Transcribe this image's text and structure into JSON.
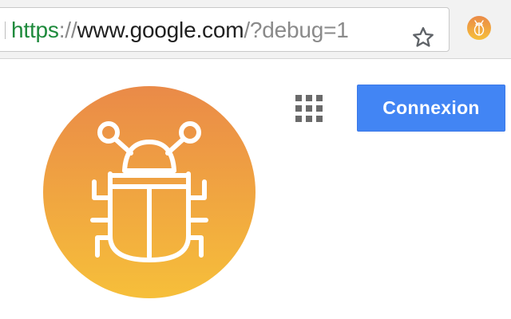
{
  "browser": {
    "url": {
      "scheme": "https",
      "separator": "://",
      "host": "www.google.com",
      "path": "/?debug=1"
    },
    "bookmark_icon": "star-icon",
    "extension_icon": "debug-extension-icon"
  },
  "page": {
    "logo_icon": "bug-icon",
    "apps_icon": "apps-grid-icon",
    "signin_label": "Connexion"
  },
  "colors": {
    "scheme_green": "#1e8a3c",
    "signin_blue": "#4285f4",
    "logo_gradient_top": "#ea8a48",
    "logo_gradient_bottom": "#f6bf3a"
  }
}
